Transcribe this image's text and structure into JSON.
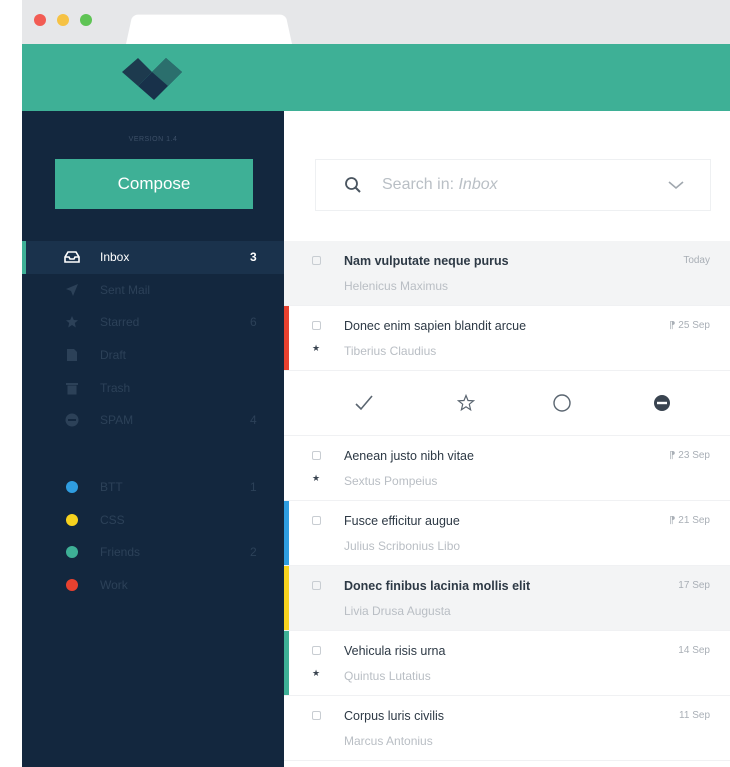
{
  "app": {
    "version": "VERSION 1.4",
    "compose_label": "Compose",
    "accent_color": "#3eb096"
  },
  "folders": [
    {
      "label": "Inbox",
      "count": "3",
      "icon": "inbox-icon",
      "active": true
    },
    {
      "label": "Sent Mail",
      "count": "",
      "icon": "send-icon"
    },
    {
      "label": "Starred",
      "count": "6",
      "icon": "star-icon"
    },
    {
      "label": "Draft",
      "count": "",
      "icon": "draft-icon"
    },
    {
      "label": "Trash",
      "count": "",
      "icon": "trash-icon"
    },
    {
      "label": "SPAM",
      "count": "4",
      "icon": "spam-icon"
    }
  ],
  "labels": [
    {
      "label": "BTT",
      "count": "1",
      "color": "#2f9de0"
    },
    {
      "label": "CSS",
      "count": "",
      "color": "#f7d21e"
    },
    {
      "label": "Friends",
      "count": "2",
      "color": "#3eb096"
    },
    {
      "label": "Work",
      "count": "",
      "color": "#e8412f"
    }
  ],
  "search": {
    "prefix": "Search in: ",
    "scope": "Inbox"
  },
  "mails": [
    {
      "subject": "Nam vulputate neque purus",
      "sender": "Helenicus Maximus",
      "date": "Today",
      "bold": true,
      "shaded": true,
      "starred": false,
      "accent": ""
    },
    {
      "subject": "Donec enim sapien blandit arcue",
      "sender": "Tiberius Claudius",
      "date": "25 Sep",
      "bold": false,
      "shaded": false,
      "starred": true,
      "accent": "#e8412f",
      "attachment": true
    },
    {
      "subject": "Aenean justo nibh vitae",
      "sender": "Sextus Pompeius",
      "date": "23 Sep",
      "bold": false,
      "shaded": false,
      "starred": true,
      "accent": "",
      "attachment": true
    },
    {
      "subject": "Fusce efficitur augue",
      "sender": "Julius Scribonius Libo",
      "date": "21 Sep",
      "bold": false,
      "shaded": false,
      "starred": false,
      "accent": "#2f9de0",
      "attachment": true
    },
    {
      "subject": "Donec finibus lacinia mollis elit",
      "sender": "Livia Drusa Augusta",
      "date": "17 Sep",
      "bold": true,
      "shaded": true,
      "starred": false,
      "accent": "#f7d21e"
    },
    {
      "subject": "Vehicula risis urna",
      "sender": "Quintus Lutatius",
      "date": "14 Sep",
      "bold": false,
      "shaded": false,
      "starred": true,
      "accent": "#3eb096"
    },
    {
      "subject": "Corpus luris civilis",
      "sender": "Marcus Antonius",
      "date": "11 Sep",
      "bold": false,
      "shaded": false,
      "starred": false,
      "accent": ""
    }
  ],
  "actions": [
    {
      "icon": "check-icon"
    },
    {
      "icon": "star-outline-icon"
    },
    {
      "icon": "circle-icon"
    },
    {
      "icon": "block-icon"
    }
  ]
}
